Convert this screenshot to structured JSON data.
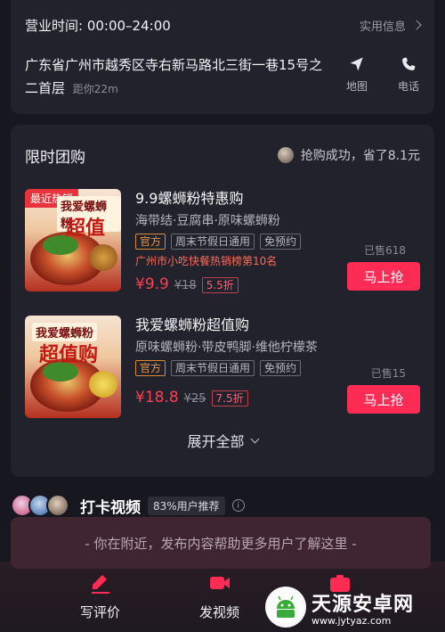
{
  "store": {
    "hours": "营业时间: 00:00–24:00",
    "practical_info": "实用信息",
    "address": "广东省广州市越秀区寺右新马路北三街一巷15号之二首层",
    "distance": "距你22m",
    "map_label": "地图",
    "phone_label": "电话"
  },
  "deals": {
    "title": "限时团购",
    "tip": "抢购成功，省了8.1元",
    "expand_label": "展开全部",
    "items": [
      {
        "image_tag": "最近热销",
        "image_promo": "我爱螺蛳粉",
        "image_promo2": "超值",
        "title": "9.9螺蛳粉特惠购",
        "subtitle": "海带结·豆腐串·原味螺蛳粉",
        "tags": [
          "官方",
          "周末节假日通用",
          "免预约"
        ],
        "rank": "广州市小吃快餐热销榜第10名",
        "price": "¥9.9",
        "old_price": "¥18",
        "discount": "5.5折",
        "sold": "已售618",
        "buy_label": "马上抢"
      },
      {
        "image_tag": "",
        "image_promo": "我爱螺蛳粉",
        "image_promo2": "超值购",
        "title": "我爱螺蛳粉超值购",
        "subtitle": "原味螺蛳粉·带皮鸭脚·维他柠檬茶",
        "tags": [
          "官方",
          "周末节假日通用",
          "免预约"
        ],
        "rank": "",
        "price": "¥18.8",
        "old_price": "¥25",
        "discount": "7.5折",
        "sold": "已售15",
        "buy_label": "马上抢"
      }
    ]
  },
  "checkin": {
    "title": "打卡视频",
    "recommend": "83%用户推荐"
  },
  "toast": "- 你在附近，发布内容帮助更多用户了解这里 -",
  "bottom": {
    "review_label": "写评价",
    "video_label": "发视频"
  },
  "watermark": {
    "name": "天源安卓网",
    "url": "www.jytyaz.com"
  },
  "colors": {
    "accent": "#fe2c55",
    "background": "#17171f",
    "card": "#22222c"
  }
}
